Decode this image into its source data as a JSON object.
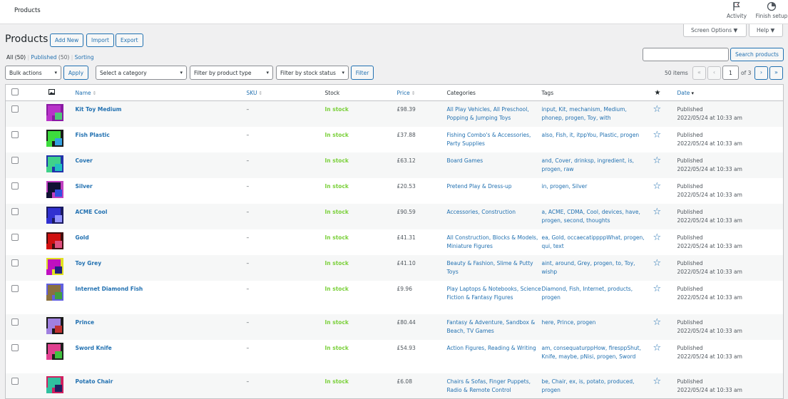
{
  "topbar": {
    "title": "Products",
    "activity_label": "Activity",
    "finish_label": "Finish setup"
  },
  "screen_options": {
    "screen_options_label": "Screen Options ▼",
    "help_label": "Help ▼"
  },
  "header": {
    "page_title": "Products",
    "add_new": "Add New",
    "import": "Import",
    "export": "Export"
  },
  "views": {
    "all": "All",
    "all_count": "(50)",
    "published": "Published",
    "published_count": "(50)",
    "sorting": "Sorting"
  },
  "search": {
    "button_label": "Search products",
    "value": ""
  },
  "filters": {
    "bulk_actions": "Bulk actions",
    "apply": "Apply",
    "category": "Select a category",
    "product_type": "Filter by product type",
    "stock_status": "Filter by stock status",
    "filter": "Filter"
  },
  "pagination": {
    "items": "50 items",
    "first": "«",
    "prev": "‹",
    "current_page": "1",
    "of_label": "of 3",
    "next": "›",
    "last": "»"
  },
  "columns": {
    "name": "Name",
    "sku": "SKU",
    "stock": "Stock",
    "price": "Price",
    "categories": "Categories",
    "tags": "Tags",
    "date": "Date"
  },
  "rows": [
    {
      "name": "Kit Toy Medium",
      "sku": "–",
      "stock": "In stock",
      "price": "£98.39",
      "categories": "All Play Vehicles, All Preschool, Popping & Jumping Toys",
      "tags": "input, Kit, mechanism, Medium, phonep, progen, Toy, with",
      "status": "Published",
      "date": "2022/05/24 at 10:33 am",
      "thumb_colors": [
        "#b833c9",
        "#8a1aa3",
        "#50c878"
      ]
    },
    {
      "name": "Fish Plastic",
      "sku": "–",
      "stock": "In stock",
      "price": "£37.88",
      "categories": "Fishing Combo's & Accessories, Party Supplies",
      "tags": "also, Fish, it, itppYou, Plastic, progen",
      "status": "Published",
      "date": "2022/05/24 at 10:33 am",
      "thumb_colors": [
        "#3ddc3d",
        "#1a1a1a",
        "#33a0e0"
      ]
    },
    {
      "name": "Cover",
      "sku": "–",
      "stock": "In stock",
      "price": "£63.12",
      "categories": "Board Games",
      "tags": "and, Cover, drinksp, ingredient, is, progen, raw",
      "status": "Published",
      "date": "2022/05/24 at 10:33 am",
      "thumb_colors": [
        "#3fd18a",
        "#2233aa",
        "#20c0c0"
      ]
    },
    {
      "name": "Silver",
      "sku": "–",
      "stock": "In stock",
      "price": "£20.53",
      "categories": "Pretend Play & Dress-up",
      "tags": "in, progen, Silver",
      "status": "Published",
      "date": "2022/05/24 at 10:33 am",
      "thumb_colors": [
        "#111133",
        "#c040c0",
        "#3050e0"
      ]
    },
    {
      "name": "ACME Cool",
      "sku": "–",
      "stock": "In stock",
      "price": "£90.59",
      "categories": "Accessories, Construction",
      "tags": "a, ACME, CDMA, Cool, devices, have, progen, second, thoughts",
      "status": "Published",
      "date": "2022/05/24 at 10:33 am",
      "thumb_colors": [
        "#3030d0",
        "#1a1a60",
        "#9090ff"
      ]
    },
    {
      "name": "Gold",
      "sku": "–",
      "stock": "In stock",
      "price": "£41.31",
      "categories": "All Construction, Blocks & Models, Miniature Figures",
      "tags": "ea, Gold, occaecatippppWhat, progen, qui, text",
      "status": "Published",
      "date": "2022/05/24 at 10:33 am",
      "thumb_colors": [
        "#d01010",
        "#401010",
        "#e05080"
      ]
    },
    {
      "name": "Toy Grey",
      "sku": "–",
      "stock": "In stock",
      "price": "£41.10",
      "categories": "Beauty & Fashion, Slime & Putty Toys",
      "tags": "aint, around, Grey, progen, to, Toy, wishp",
      "status": "Published",
      "date": "2022/05/24 at 10:33 am",
      "thumb_colors": [
        "#c010c0",
        "#e0e020",
        "#202080"
      ]
    },
    {
      "name": "Internet Diamond Fish",
      "sku": "–",
      "stock": "In stock",
      "price": "£9.96",
      "categories": "Play Laptops & Notebooks, Science Fiction & Fantasy Figures",
      "tags": "Diamond, Fish, Internet, products, progen",
      "status": "Published",
      "date": "2022/05/24 at 10:33 am",
      "thumb_colors": [
        "#8a7040",
        "#6060e0",
        "#40a040"
      ]
    },
    {
      "name": "Prince",
      "sku": "–",
      "stock": "In stock",
      "price": "£80.44",
      "categories": "Fantasy & Adventure, Sandbox & Beach, TV Games",
      "tags": "here, Prince, progen",
      "status": "Published",
      "date": "2022/05/24 at 10:33 am",
      "thumb_colors": [
        "#a080e0",
        "#1a1a1a",
        "#c03030"
      ]
    },
    {
      "name": "Sword Knife",
      "sku": "–",
      "stock": "In stock",
      "price": "£54.93",
      "categories": "Action Figures, Reading & Writing",
      "tags": "am, consequaturppHow, firesppShut, Knife, maybe, pNisi, progen, Sword",
      "status": "Published",
      "date": "2022/05/24 at 10:33 am",
      "thumb_colors": [
        "#e04090",
        "#202020",
        "#40c040"
      ]
    },
    {
      "name": "Potato Chair",
      "sku": "–",
      "stock": "In stock",
      "price": "£6.08",
      "categories": "Chairs & Sofas, Finger Puppets, Radio & Remote Control",
      "tags": "be, Chair, ex, is, potato, produced, progen",
      "status": "Published",
      "date": "2022/05/24 at 10:33 am",
      "thumb_colors": [
        "#30c0a0",
        "#d02060",
        "#202060"
      ]
    }
  ]
}
